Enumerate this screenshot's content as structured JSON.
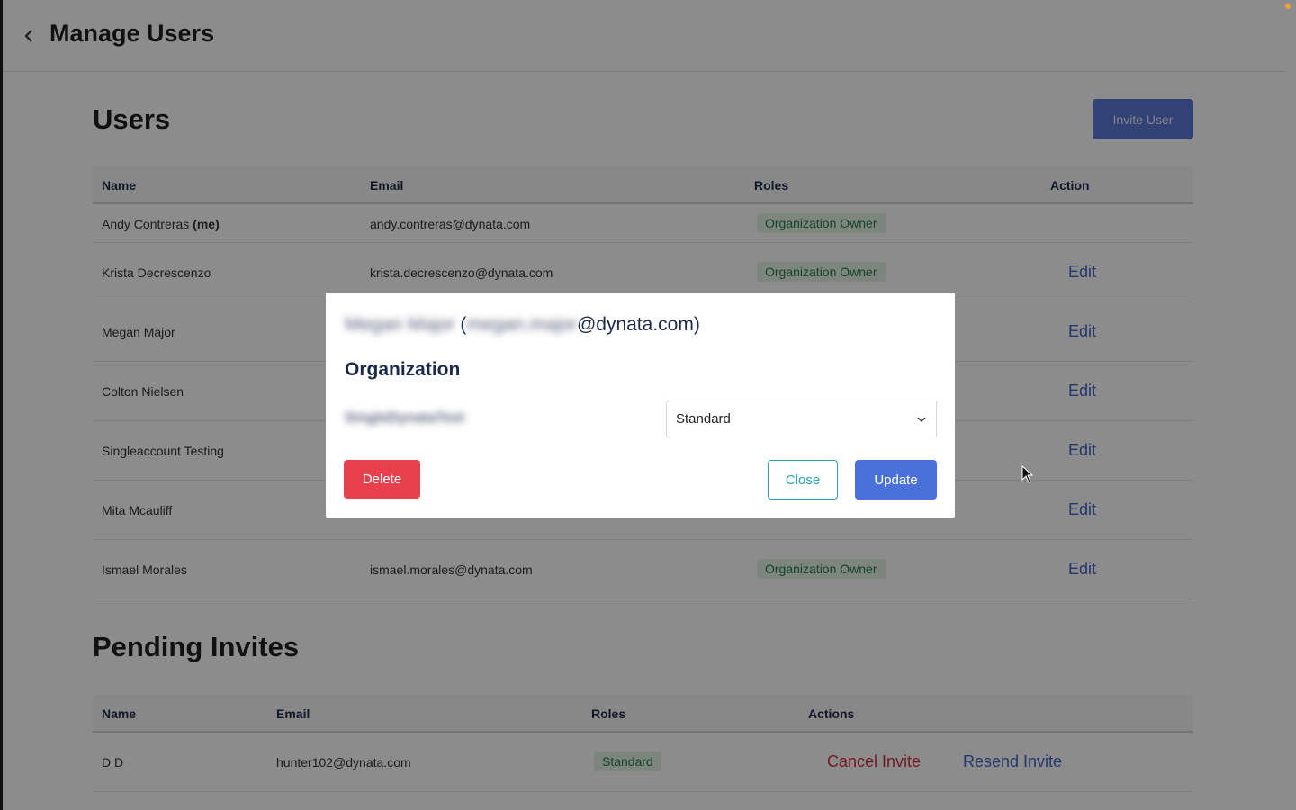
{
  "header": {
    "title": "Manage Users"
  },
  "users": {
    "title": "Users",
    "invite_button": "Invite User",
    "columns": {
      "name": "Name",
      "email": "Email",
      "roles": "Roles",
      "action": "Action"
    },
    "me_suffix": "(me)",
    "edit_label": "Edit",
    "rows": [
      {
        "name": "Andy Contreras",
        "email": "andy.contreras@dynata.com",
        "role": "Organization Owner"
      },
      {
        "name": "Krista Decrescenzo",
        "email": "krista.decrescenzo@dynata.com",
        "role": "Organization Owner"
      },
      {
        "name": "Megan Major"
      },
      {
        "name": "Colton Nielsen"
      },
      {
        "name": "Singleaccount Testing"
      },
      {
        "name": "Mita Mcauliff"
      },
      {
        "name": "Ismael Morales",
        "email": "ismael.morales@dynata.com",
        "role": "Organization Owner"
      }
    ]
  },
  "pending": {
    "title": "Pending Invites",
    "columns": {
      "name": "Name",
      "email": "Email",
      "roles": "Roles",
      "actions": "Actions"
    },
    "rows": [
      {
        "name": "D D",
        "email": "hunter102@dynata.com",
        "role": "Standard",
        "cancel": "Cancel Invite",
        "resend": "Resend Invite"
      }
    ]
  },
  "modal": {
    "title_name": "Megan Major",
    "title_open": " (",
    "title_email_local": "megan.major",
    "title_email_domain": "@dynata.com)",
    "section_heading": "Organization",
    "org_name": "SingleDynataTest",
    "role_value": "Standard",
    "delete_label": "Delete",
    "close_label": "Close",
    "update_label": "Update"
  },
  "colors": {
    "primary": "#4a70d9",
    "danger": "#e8404d",
    "close_outline": "#2aa0b8",
    "badge_bg": "#e3f2e8",
    "badge_text": "#2b7a4b",
    "heading": "#1c2a4a"
  },
  "icons": {
    "back": "chevron-left-icon",
    "select": "chevron-down-icon",
    "cursor": "mouse-pointer-icon"
  }
}
